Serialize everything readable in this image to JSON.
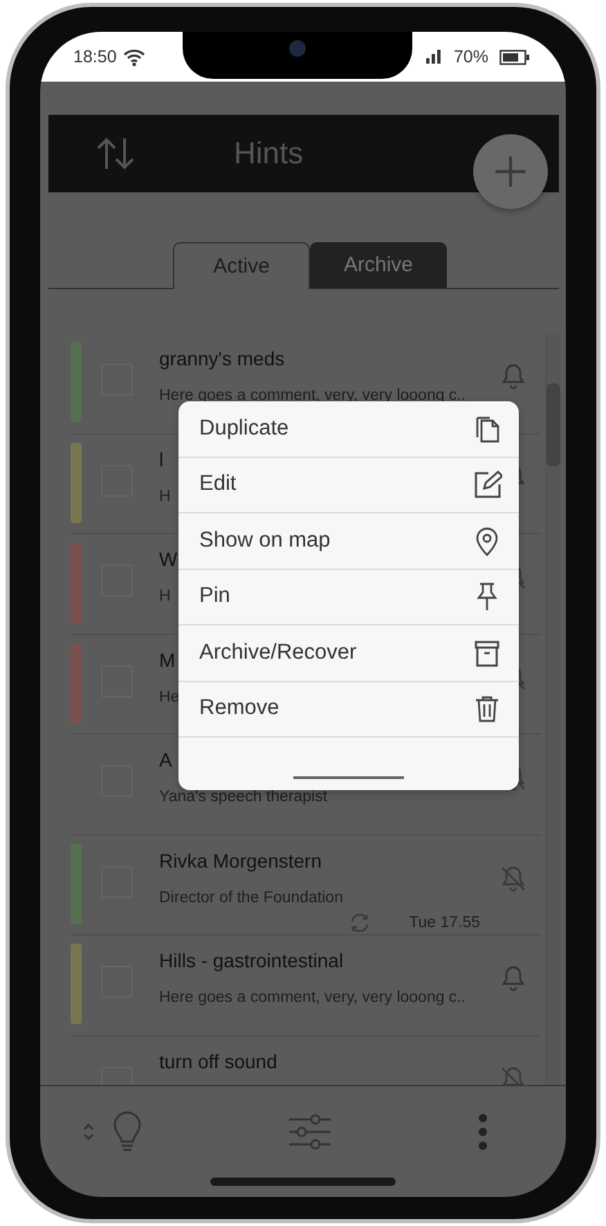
{
  "status_bar": {
    "time": "18:50",
    "battery": "70%"
  },
  "header": {
    "title": "Hints"
  },
  "tabs": [
    {
      "label": "Active",
      "selected": true
    },
    {
      "label": "Archive",
      "selected": false
    }
  ],
  "hints": [
    {
      "title": "granny's meds",
      "comment": "Here goes a comment, very, very looong c..",
      "color": "#56704f",
      "checked": false,
      "alarm": true
    },
    {
      "title": "l",
      "comment": "H",
      "color": "#7a7650",
      "checked": false,
      "alarm": true
    },
    {
      "title": "W",
      "comment": "H",
      "color": "#7d4f4f",
      "checked": false,
      "alarm": false
    },
    {
      "title": "M",
      "comment": "He",
      "color": "#7d4f4f",
      "checked": false,
      "alarm": false
    },
    {
      "title": "A",
      "comment": "Yana's speech therapist",
      "checked": false,
      "alarm": false
    },
    {
      "title": "Rivka Morgenstern",
      "comment": "Director of  the Foundation",
      "color": "#56704f",
      "checked": false,
      "alarm": false,
      "time": "Tue 17.55"
    },
    {
      "title": "Hills - gastrointestinal",
      "comment": "Here goes a comment, very, very looong c..",
      "color": "#7a7650",
      "checked": false,
      "alarm": true
    },
    {
      "title": "turn off sound",
      "checked": false,
      "alarm": false
    }
  ],
  "context_menu": [
    {
      "label": "Duplicate",
      "kind": "duplicate"
    },
    {
      "label": "Edit",
      "kind": "edit"
    },
    {
      "label": "Show on map",
      "kind": "location"
    },
    {
      "label": "Pin",
      "kind": "pin"
    },
    {
      "label": "Archive/Recover",
      "kind": "archive"
    },
    {
      "label": "Remove",
      "kind": "trash"
    }
  ]
}
